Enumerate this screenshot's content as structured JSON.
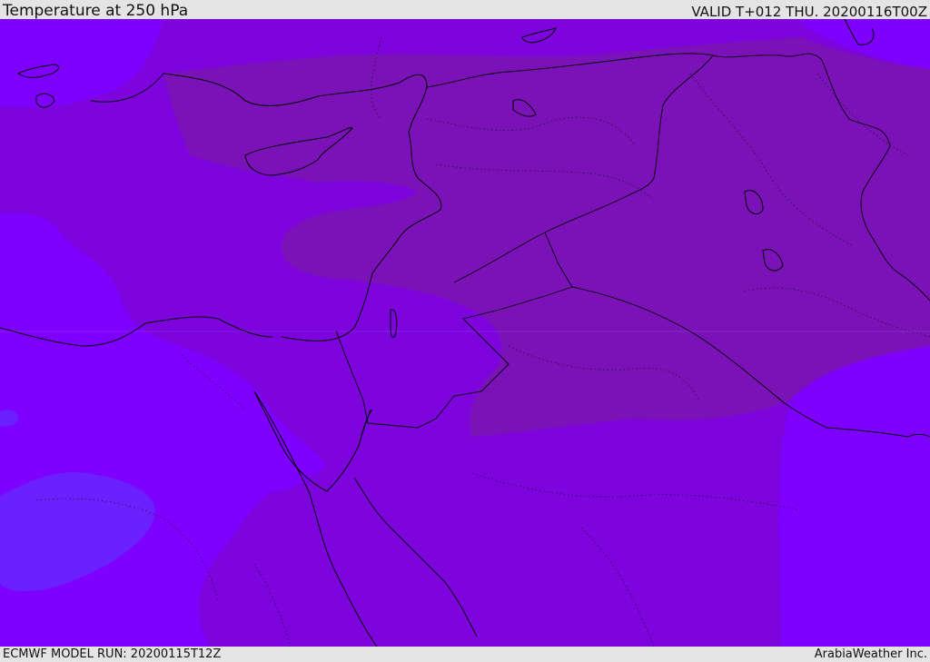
{
  "header": {
    "title": "Temperature at 250 hPa",
    "valid": "VALID T+012 THU. 20200116T00Z"
  },
  "footer": {
    "model_run": "ECMWF MODEL RUN: 20200115T12Z",
    "credit": "ArabiaWeather Inc."
  },
  "map": {
    "field": "temperature",
    "level": "250 hPa",
    "colors": {
      "warmest_band": "#7a12b8",
      "middle_band": "#7d04dd",
      "coolest_band": "#7e00ff",
      "cold_pocket": "#6a20ff",
      "coastline": "#000000"
    }
  }
}
